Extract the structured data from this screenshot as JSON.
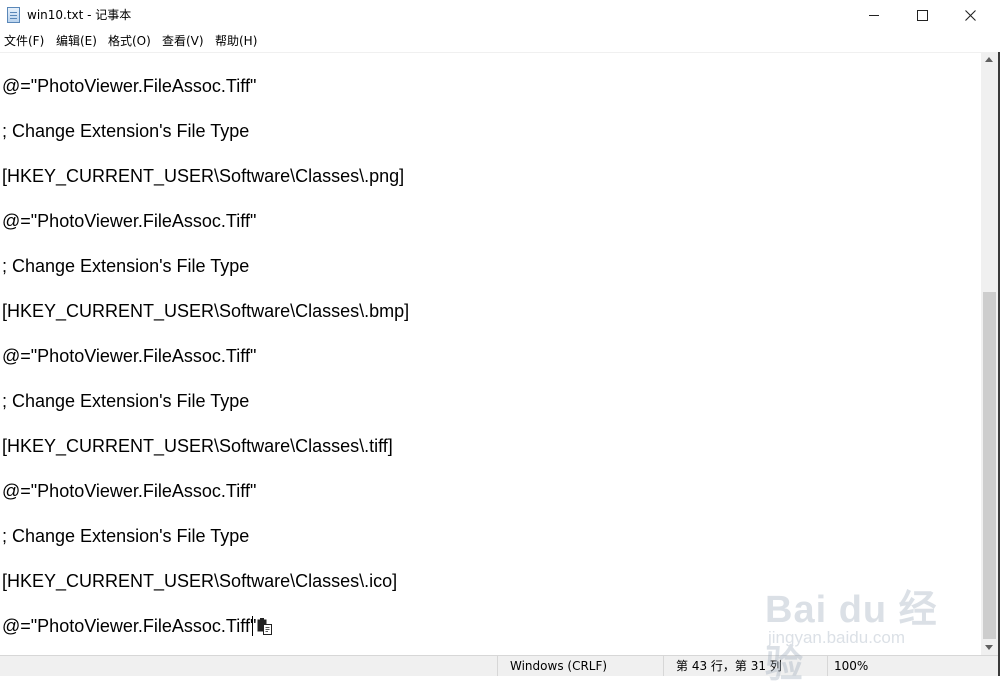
{
  "window": {
    "title": "win10.txt - 记事本",
    "minimize_icon": "minimize-icon",
    "maximize_icon": "maximize-icon",
    "close_icon": "close-icon"
  },
  "menu": [
    "文件(F)",
    "编辑(E)",
    "格式(O)",
    "查看(V)",
    "帮助(H)"
  ],
  "editor": {
    "lines": [
      "@=\"PhotoViewer.FileAssoc.Tiff\"",
      "; Change Extension's File Type",
      "[HKEY_CURRENT_USER\\Software\\Classes\\.png]",
      "@=\"PhotoViewer.FileAssoc.Tiff\"",
      "; Change Extension's File Type",
      "[HKEY_CURRENT_USER\\Software\\Classes\\.bmp]",
      "@=\"PhotoViewer.FileAssoc.Tiff\"",
      "; Change Extension's File Type",
      "[HKEY_CURRENT_USER\\Software\\Classes\\.tiff]",
      "@=\"PhotoViewer.FileAssoc.Tiff\"",
      "; Change Extension's File Type",
      "[HKEY_CURRENT_USER\\Software\\Classes\\.ico]",
      "@=\"PhotoViewer.FileAssoc.Tiff\""
    ],
    "paste_icon": "paste-options-icon"
  },
  "status": {
    "encoding": "Windows (CRLF)",
    "position": "第 43 行，第 31 列",
    "zoom": "100%"
  },
  "watermark": {
    "main": "Bai du 经验",
    "sub": "jingyan.baidu.com"
  }
}
